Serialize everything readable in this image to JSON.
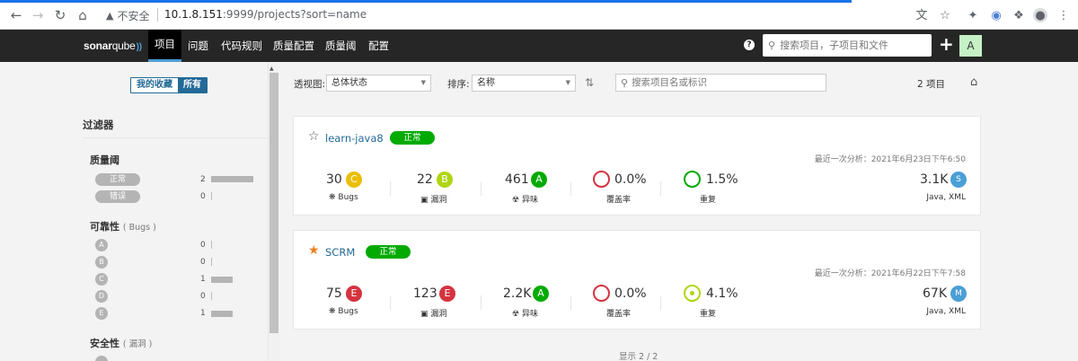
{
  "browser": {
    "security_label": "不安全",
    "url_host": "10.1.8.151",
    "url_rest": ":9999/projects?sort=name"
  },
  "topnav": {
    "logo_bold": "sonar",
    "logo_thin": "qube",
    "items": [
      "项目",
      "问题",
      "代码规则",
      "质量配置",
      "质量阈",
      "配置"
    ],
    "search_placeholder": "搜索项目，子项目和文件",
    "avatar": "A"
  },
  "sidebar": {
    "toggle": [
      "我的收藏",
      "所有"
    ],
    "filter_title": "过滤器",
    "quality_gate": {
      "title": "质量阈",
      "items": [
        {
          "label": "正常",
          "count": "2"
        },
        {
          "label": "错误",
          "count": "0"
        }
      ]
    },
    "reliability": {
      "title": "可靠性",
      "sub": "( Bugs )",
      "items": [
        {
          "label": "A",
          "count": "0"
        },
        {
          "label": "B",
          "count": "0"
        },
        {
          "label": "C",
          "count": "1"
        },
        {
          "label": "D",
          "count": "0"
        },
        {
          "label": "E",
          "count": "1"
        }
      ]
    },
    "security": {
      "title": "安全性",
      "sub": "( 漏洞 )"
    }
  },
  "toolbar": {
    "view_label": "透视图:",
    "view_value": "总体状态",
    "sort_label": "排序:",
    "sort_value": "名称",
    "search_placeholder": "搜索项目名或标识",
    "count": "2 项目"
  },
  "projects": [
    {
      "name": "learn-java8",
      "favorite": false,
      "status": "正常",
      "last_analysis": "最近一次分析：2021年6月23日下午6:50",
      "bugs": "30",
      "bugs_rating": "C",
      "bugs_label": "Bugs",
      "vulns": "22",
      "vulns_rating": "B",
      "vulns_label": "漏洞",
      "smells": "461",
      "smells_rating": "A",
      "smells_label": "异味",
      "coverage": "0.0%",
      "coverage_label": "覆盖率",
      "dup": "1.5%",
      "dup_label": "重复",
      "size": "3.1K",
      "size_rating": "S",
      "languages": "Java, XML"
    },
    {
      "name": "SCRM",
      "favorite": true,
      "status": "正常",
      "last_analysis": "最近一次分析：2021年6月22日下午7:58",
      "bugs": "75",
      "bugs_rating": "E",
      "bugs_label": "Bugs",
      "vulns": "123",
      "vulns_rating": "E",
      "vulns_label": "漏洞",
      "smells": "2.2K",
      "smells_rating": "A",
      "smells_label": "异味",
      "coverage": "0.0%",
      "coverage_label": "覆盖率",
      "dup": "4.1%",
      "dup_label": "重复",
      "size": "67K",
      "size_rating": "M",
      "languages": "Java, XML"
    }
  ],
  "footer": "显示 2 / 2",
  "colors": {
    "rating_A": "#00aa00",
    "rating_B": "#b0d513",
    "rating_C": "#eabe06",
    "rating_E": "#d4333f",
    "size": "#4b9fd5",
    "accent": "#236a97"
  }
}
